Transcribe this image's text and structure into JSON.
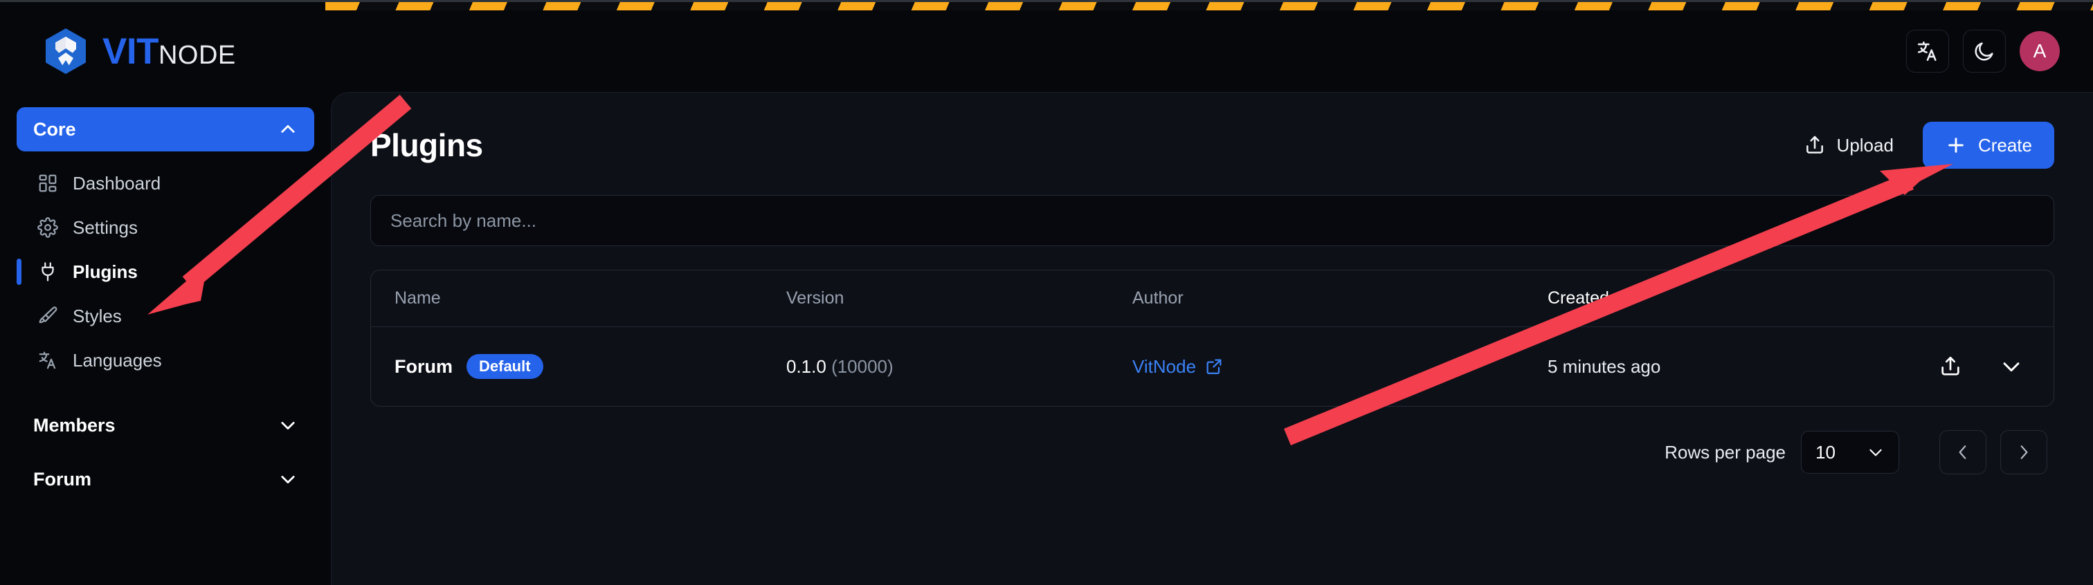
{
  "brand": {
    "word_primary": "VIT",
    "word_secondary": "NODE",
    "logo_icon": "vitnode-hexagon-logo"
  },
  "topbar": {
    "language_icon": "translate-icon",
    "theme_icon": "moon-icon",
    "avatar_initial": "A"
  },
  "sidebar": {
    "sections": [
      {
        "label": "Core",
        "state": "expanded",
        "chevron_icon": "chevron-up-icon",
        "items": [
          {
            "label": "Dashboard",
            "icon": "dashboard-grid-icon",
            "current": false
          },
          {
            "label": "Settings",
            "icon": "gear-icon",
            "current": false
          },
          {
            "label": "Plugins",
            "icon": "plug-icon",
            "current": true
          },
          {
            "label": "Styles",
            "icon": "paintbrush-icon",
            "current": false
          },
          {
            "label": "Languages",
            "icon": "translate-icon",
            "current": false
          }
        ]
      },
      {
        "label": "Members",
        "state": "collapsed",
        "chevron_icon": "chevron-down-icon",
        "items": []
      },
      {
        "label": "Forum",
        "state": "collapsed",
        "chevron_icon": "chevron-down-icon",
        "items": []
      }
    ]
  },
  "main": {
    "title": "Plugins",
    "upload_label": "Upload",
    "upload_icon": "upload-icon",
    "create_label": "Create",
    "create_icon": "plus-icon",
    "search": {
      "value": "",
      "placeholder": "Search by name..."
    },
    "table": {
      "columns": [
        {
          "key": "name",
          "label": "Name",
          "sorted": false
        },
        {
          "key": "version",
          "label": "Version",
          "sorted": false
        },
        {
          "key": "author",
          "label": "Author",
          "sorted": false
        },
        {
          "key": "created",
          "label": "Created",
          "sorted": true,
          "sort_icon": "arrow-down-icon",
          "sort_direction": "desc"
        }
      ],
      "rows": [
        {
          "name": "Forum",
          "badge": "Default",
          "version_main": "0.1.0",
          "version_sub": "(10000)",
          "author": "VitNode",
          "author_icon": "external-link-icon",
          "created": "5 minutes ago",
          "actions": [
            {
              "icon": "upload-icon",
              "name": "row-upload-button"
            },
            {
              "icon": "chevron-down-icon",
              "name": "row-expand-button"
            }
          ]
        }
      ]
    },
    "pagination": {
      "rows_per_page_label": "Rows per page",
      "rows_per_page_value": "10",
      "rows_select_icon": "chevron-down-icon",
      "prev_icon": "chevron-left-icon",
      "next_icon": "chevron-right-icon"
    }
  },
  "colors": {
    "accent": "#2563eb",
    "page_bg": "#05070b",
    "panel_bg": "#0d1017",
    "link": "#3b82f6",
    "avatar_bg": "#b5315f",
    "annotation": "#f43f4e",
    "caution_stripe": "#fbaa19"
  }
}
